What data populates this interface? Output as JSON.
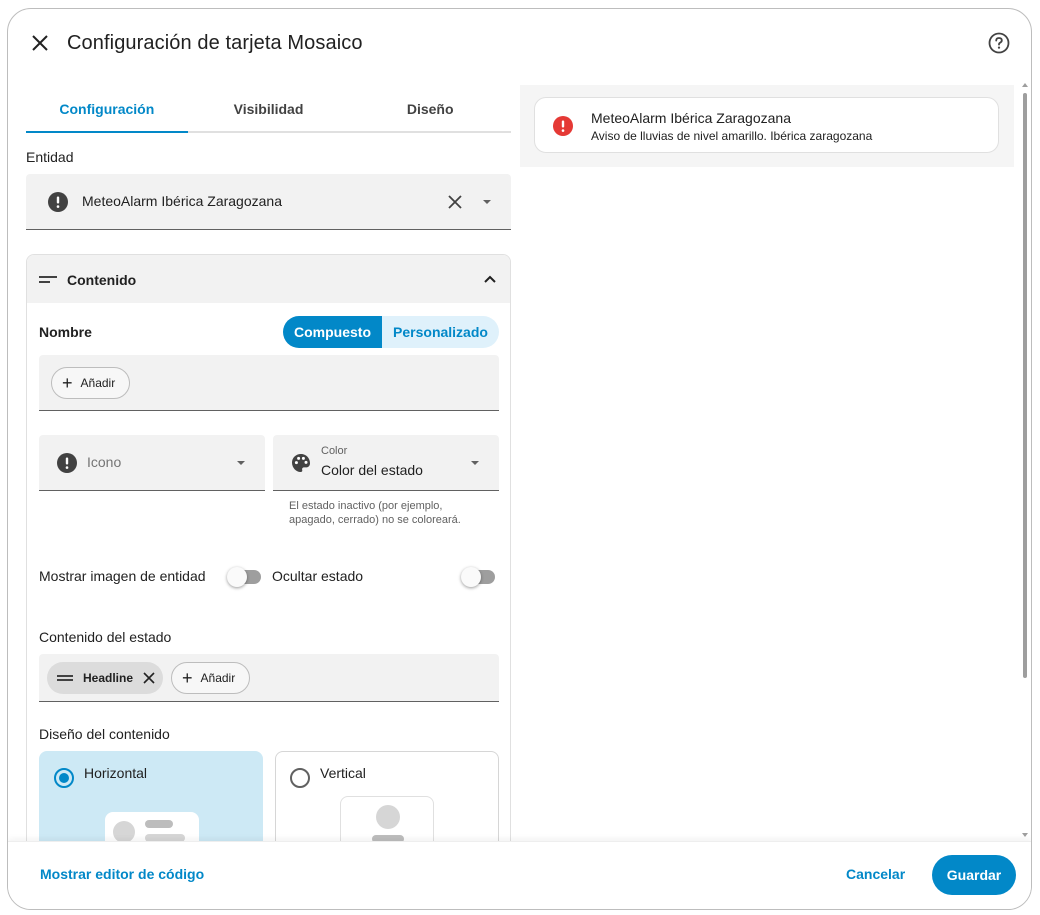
{
  "dialog": {
    "title": "Configuración de tarjeta Mosaico"
  },
  "tabs": [
    {
      "label": "Configuración",
      "active": true
    },
    {
      "label": "Visibilidad",
      "active": false
    },
    {
      "label": "Diseño",
      "active": false
    }
  ],
  "entity": {
    "label": "Entidad",
    "value": "MeteoAlarm Ibérica Zaragozana",
    "icon": "alert-circle-icon"
  },
  "content_panel": {
    "title": "Contenido",
    "name_label": "Nombre",
    "name_mode": {
      "options": [
        "Compuesto",
        "Personalizado"
      ],
      "selected": "Compuesto"
    },
    "add_label": "Añadir",
    "icon_field": {
      "placeholder": "Icono"
    },
    "color_field": {
      "label": "Color",
      "value": "Color del estado",
      "hint": "El estado inactivo (por ejemplo, apagado, cerrado) no se coloreará."
    },
    "show_entity_image": {
      "label": "Mostrar imagen de entidad",
      "on": false
    },
    "hide_state": {
      "label": "Ocultar estado",
      "on": false
    },
    "state_content": {
      "label": "Contenido del estado",
      "chips": [
        "Headline"
      ],
      "add_label": "Añadir"
    },
    "content_layout": {
      "label": "Diseño del contenido",
      "options": [
        "Horizontal",
        "Vertical"
      ],
      "selected": "Horizontal"
    }
  },
  "preview": {
    "name": "MeteoAlarm Ibérica Zaragozana",
    "state": "Aviso de lluvias de nivel amarillo. Ibérica zaragozana",
    "icon": "alert-circle-icon",
    "icon_color": "#e53935"
  },
  "footer": {
    "code_editor_label": "Mostrar editor de código",
    "cancel_label": "Cancelar",
    "save_label": "Guardar"
  },
  "colors": {
    "accent": "#0288c8",
    "accent_light": "#dff1fb",
    "selected_card": "#cde9f5"
  }
}
